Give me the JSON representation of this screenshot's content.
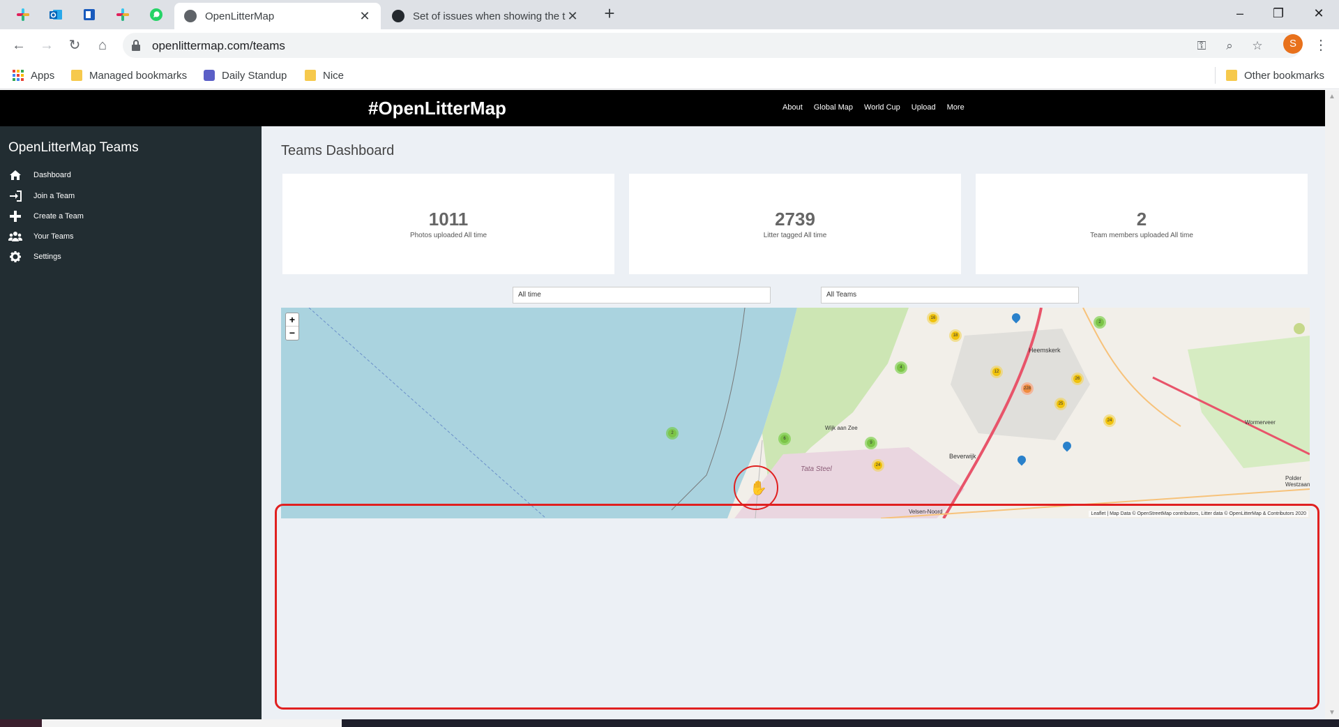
{
  "browser": {
    "tabs": [
      {
        "title": "OpenLitterMap",
        "active": true
      },
      {
        "title": "Set of issues when showing the t",
        "active": false
      }
    ],
    "url": "openlittermap.com/teams",
    "profile_initial": "S",
    "bookmarks": [
      {
        "label": "Apps",
        "icon": "apps-grid-icon"
      },
      {
        "label": "Managed bookmarks",
        "icon": "folder-icon"
      },
      {
        "label": "Daily Standup",
        "icon": "teams-icon"
      },
      {
        "label": "Nice",
        "icon": "folder-icon"
      }
    ],
    "other_bookmarks": "Other bookmarks"
  },
  "site": {
    "brand": "#OpenLitterMap",
    "nav": [
      "About",
      "Global Map",
      "World Cup",
      "Upload",
      "More"
    ]
  },
  "sidebar": {
    "title": "OpenLitterMap Teams",
    "items": [
      {
        "label": "Dashboard",
        "icon": "home-icon"
      },
      {
        "label": "Join a Team",
        "icon": "sign-in-icon"
      },
      {
        "label": "Create a Team",
        "icon": "plus-icon"
      },
      {
        "label": "Your Teams",
        "icon": "users-icon"
      },
      {
        "label": "Settings",
        "icon": "gear-icon"
      }
    ]
  },
  "dashboard": {
    "title": "Teams Dashboard",
    "stats": [
      {
        "value": "1011",
        "label": "Photos uploaded All time"
      },
      {
        "value": "2739",
        "label": "Litter tagged All time"
      },
      {
        "value": "2",
        "label": "Team members uploaded All time"
      }
    ],
    "time_filter": "All time",
    "team_filter": "All Teams"
  },
  "map": {
    "zoom_in": "+",
    "zoom_out": "−",
    "places": [
      "Heemskerk",
      "Wijk aan Zee",
      "Beverwijk",
      "Tata Steel",
      "Velsen-Noord",
      "Wormerveer",
      "Polder Westzaan"
    ],
    "clusters": [
      "16",
      "18",
      "4",
      "12",
      "228",
      "26",
      "25",
      "24",
      "2",
      "6",
      "9",
      "2",
      "24"
    ],
    "attribution": "Leaflet | Map Data © OpenStreetMap contributors, Litter data © OpenLitterMap & Contributors 2020",
    "colors": {
      "sea": "#aad3df",
      "land": "#f2efe9",
      "green": "#cde6b4",
      "industrial": "#ead6e0",
      "highway": "#e8546a"
    }
  }
}
